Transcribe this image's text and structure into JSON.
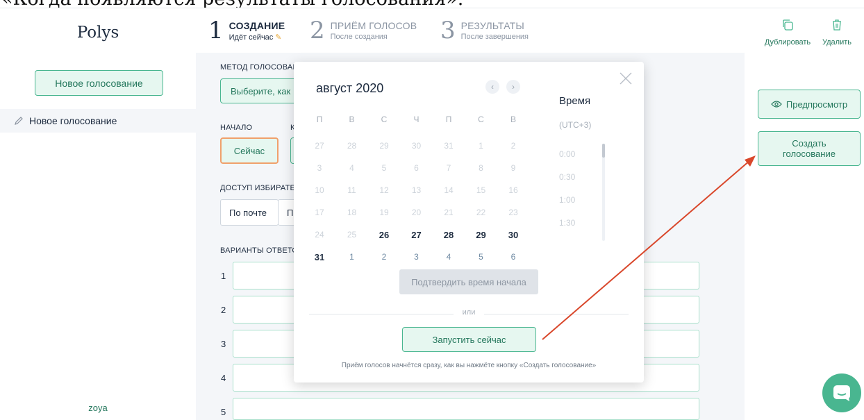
{
  "caption_text": "«Когда появляются результаты голосования».",
  "sidebar": {
    "logo": "Polys",
    "new_vote_button": "Новое голосование",
    "items": [
      {
        "label": "Новое голосование"
      }
    ],
    "user": "zoya"
  },
  "steps": [
    {
      "num": "1",
      "title": "СОЗДАНИЕ",
      "sub": "Идёт сейчас"
    },
    {
      "num": "2",
      "title": "ПРИЁМ ГОЛОСОВ",
      "sub": "После создания"
    },
    {
      "num": "3",
      "title": "РЕЗУЛЬТАТЫ",
      "sub": "После завершения"
    }
  ],
  "toolbar": {
    "duplicate": "Дублировать",
    "delete": "Удалить"
  },
  "form": {
    "method_label": "МЕТОД ГОЛОСОВАН",
    "method_button": "Выберите, как",
    "start_label": "НАЧАЛО",
    "end_label_fragment": "К",
    "now_button": "Сейчас",
    "access_label": "ДОСТУП ИЗБИРАТЕЛ",
    "access_option": "По почте",
    "access_option2": "П",
    "answers_label": "ВАРИАНТЫ ОТВЕТО",
    "answers": [
      "1",
      "2",
      "3",
      "4",
      "5"
    ]
  },
  "right_actions": {
    "preview": "Предпросмотр",
    "create": "Создать голосование"
  },
  "calendar": {
    "month": "август 2020",
    "weekdays": [
      "П",
      "В",
      "С",
      "Ч",
      "П",
      "С",
      "В"
    ],
    "weeks": [
      [
        {
          "d": "27",
          "s": "muted"
        },
        {
          "d": "28",
          "s": "muted"
        },
        {
          "d": "29",
          "s": "muted"
        },
        {
          "d": "30",
          "s": "muted"
        },
        {
          "d": "31",
          "s": "muted"
        },
        {
          "d": "1",
          "s": "muted"
        },
        {
          "d": "2",
          "s": "muted"
        }
      ],
      [
        {
          "d": "3",
          "s": "muted"
        },
        {
          "d": "4",
          "s": "muted"
        },
        {
          "d": "5",
          "s": "muted"
        },
        {
          "d": "6",
          "s": "muted"
        },
        {
          "d": "7",
          "s": "muted"
        },
        {
          "d": "8",
          "s": "muted"
        },
        {
          "d": "9",
          "s": "muted"
        }
      ],
      [
        {
          "d": "10",
          "s": "muted"
        },
        {
          "d": "11",
          "s": "muted"
        },
        {
          "d": "12",
          "s": "muted"
        },
        {
          "d": "13",
          "s": "muted"
        },
        {
          "d": "14",
          "s": "muted"
        },
        {
          "d": "15",
          "s": "muted"
        },
        {
          "d": "16",
          "s": "muted"
        }
      ],
      [
        {
          "d": "17",
          "s": "muted"
        },
        {
          "d": "18",
          "s": "muted"
        },
        {
          "d": "19",
          "s": "muted"
        },
        {
          "d": "20",
          "s": "muted"
        },
        {
          "d": "21",
          "s": "muted"
        },
        {
          "d": "22",
          "s": "muted"
        },
        {
          "d": "23",
          "s": "muted"
        }
      ],
      [
        {
          "d": "24",
          "s": "muted"
        },
        {
          "d": "25",
          "s": "muted"
        },
        {
          "d": "26",
          "s": "active"
        },
        {
          "d": "27",
          "s": "active"
        },
        {
          "d": "28",
          "s": "active"
        },
        {
          "d": "29",
          "s": "active"
        },
        {
          "d": "30",
          "s": "active"
        }
      ],
      [
        {
          "d": "31",
          "s": "active"
        },
        {
          "d": "1",
          "s": "next"
        },
        {
          "d": "2",
          "s": "next"
        },
        {
          "d": "3",
          "s": "next"
        },
        {
          "d": "4",
          "s": "next"
        },
        {
          "d": "5",
          "s": "next"
        },
        {
          "d": "6",
          "s": "next"
        }
      ]
    ],
    "time_title": "Время",
    "timezone": "(UTC+3)",
    "times": [
      "0:00",
      "0:30",
      "1:00",
      "1:30"
    ],
    "confirm_button": "Подтвердить время начала",
    "or": "или",
    "start_now_button": "Запустить сейчас",
    "note": "Приём голосов начнётся сразу, как вы нажмёте кнопку «Создать голосование»"
  },
  "colors": {
    "accent": "#49b690",
    "accent_bg": "#e6f7f0",
    "annotation_arrow": "#d9472b",
    "highlight_border": "#f0a06b"
  }
}
